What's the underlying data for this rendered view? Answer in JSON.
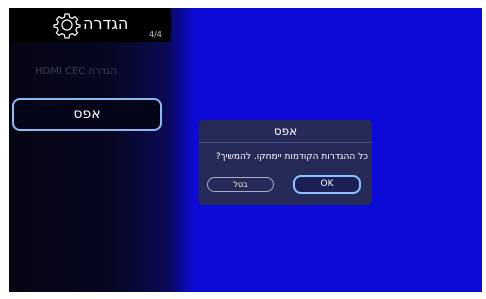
{
  "header": {
    "title": "הגדרה",
    "page_indicator": "4/4",
    "icon": "gear-icon"
  },
  "menu": {
    "hdmi_cec_label": "הגדרת HDMI CEC",
    "reset_label": "אפס"
  },
  "dialog": {
    "title": "אפס",
    "message": "כל ההגדרות הקודמות יימחקו. להמשיך?",
    "cancel_label": "בטל",
    "ok_label": "OK"
  },
  "colors": {
    "background": "#0d0ad8",
    "dialog": "#262a58",
    "focus": "#8fb7f0"
  }
}
